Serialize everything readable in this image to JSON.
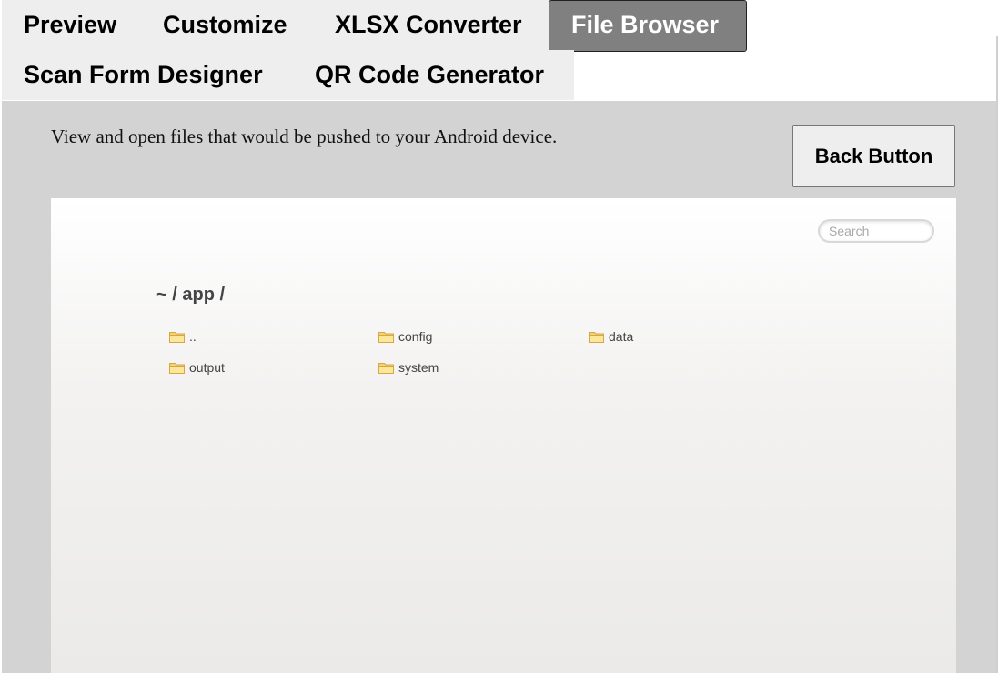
{
  "tabs": [
    {
      "label": "Preview",
      "active": false
    },
    {
      "label": "Customize",
      "active": false
    },
    {
      "label": "XLSX Converter",
      "active": false
    },
    {
      "label": "File Browser",
      "active": true
    },
    {
      "label": "Scan Form Designer",
      "active": false
    },
    {
      "label": "QR Code Generator",
      "active": false
    }
  ],
  "content": {
    "description": "View and open files that would be pushed to your Android device.",
    "back_button_label": "Back Button"
  },
  "file_browser": {
    "search_placeholder": "Search",
    "search_value": "",
    "breadcrumb": "~ / app /",
    "items": [
      {
        "name": "..",
        "type": "folder",
        "icon": "folder-icon"
      },
      {
        "name": "config",
        "type": "folder",
        "icon": "folder-icon"
      },
      {
        "name": "data",
        "type": "folder",
        "icon": "folder-icon"
      },
      {
        "name": "output",
        "type": "folder",
        "icon": "folder-icon"
      },
      {
        "name": "system",
        "type": "folder",
        "icon": "folder-icon"
      }
    ]
  },
  "colors": {
    "active_tab_bg": "#808080",
    "tab_bg": "#eeeeee",
    "content_bg": "#d3d3d3"
  }
}
